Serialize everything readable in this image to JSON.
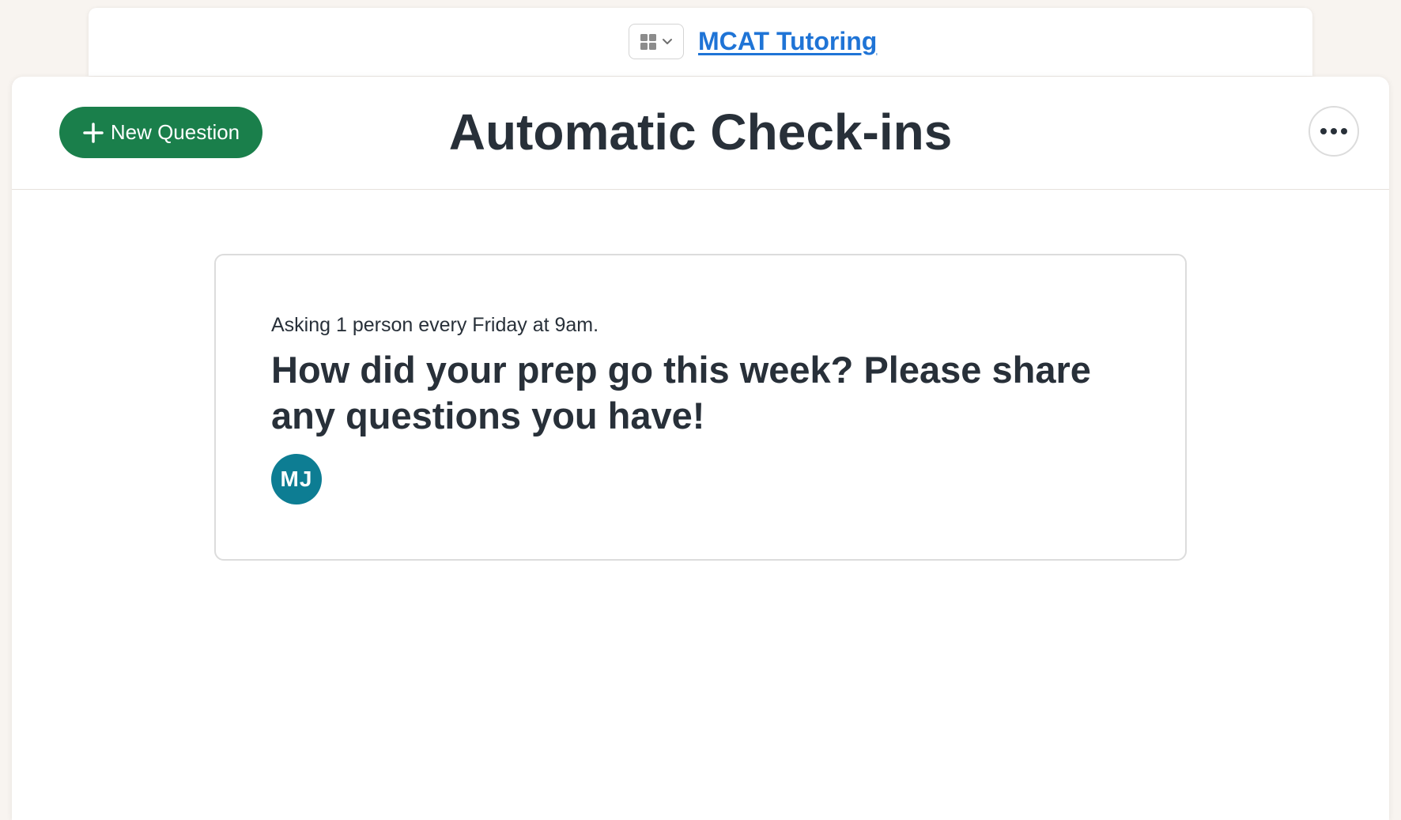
{
  "project_bar": {
    "switcher_icon": "grid-icon",
    "chevron_icon": "chevron-down-icon",
    "project_name": "MCAT Tutoring",
    "link_color": "#1f74d6"
  },
  "header": {
    "new_question_label": "New Question",
    "new_question_icon": "plus-icon",
    "title": "Automatic Check-ins",
    "more_icon": "ellipsis-icon",
    "accent_color": "#1a7f4b"
  },
  "checkins": [
    {
      "schedule": "Asking 1 person every Friday at 9am.",
      "question": "How did your prep go this week? Please share any questions you have!",
      "participants": [
        {
          "initials": "MJ",
          "color": "#0d7d93"
        }
      ]
    }
  ]
}
